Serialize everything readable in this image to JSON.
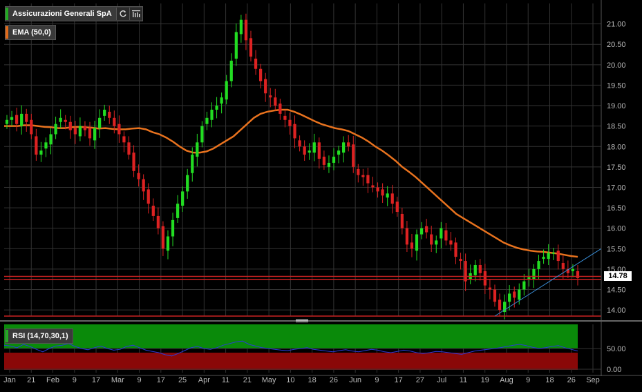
{
  "legend": {
    "instrument": "Assicurazioni Generali SpA",
    "instrument_color": "#22aa22",
    "ema_label": "EMA (50,0)",
    "ema_color": "#e06a1a",
    "rsi_label": "RSI (14,70,30,1)",
    "rsi_color": "#22aa22"
  },
  "toolbar": {
    "refresh_icon": "refresh-icon",
    "settings_icon": "bar-chart-settings-icon"
  },
  "last_price_label": "14.78",
  "colors": {
    "up": "#22dd22",
    "down": "#dd2222",
    "ema": "#e8721e",
    "trend": "#3a8fd9",
    "hline": "#cc2222",
    "rsi": "#2a3ad8",
    "overbought": "#0a8a0a",
    "oversold": "#8a0808",
    "grid": "#333333"
  },
  "chart_data": [
    {
      "type": "candlestick",
      "title": "Assicurazioni Generali SpA",
      "ylim": [
        13.85,
        21.5
      ],
      "y_ticks": [
        "14.00",
        "14.50",
        "15.00",
        "15.50",
        "16.00",
        "16.50",
        "17.00",
        "17.50",
        "18.00",
        "18.50",
        "19.00",
        "19.50",
        "20.00",
        "20.50",
        "21.00"
      ],
      "x_ticks": [
        "Jan",
        "21",
        "Feb",
        "9",
        "17",
        "Mar",
        "9",
        "17",
        "25",
        "Apr",
        "11",
        "21",
        "May",
        "10",
        "18",
        "26",
        "Jun",
        "9",
        "17",
        "27",
        "Jul",
        "11",
        "19",
        "Aug",
        "9",
        "18",
        "26",
        "Sep"
      ],
      "series_close": [
        18.65,
        18.72,
        18.55,
        18.8,
        18.6,
        18.3,
        17.8,
        17.9,
        18.1,
        18.3,
        18.55,
        18.7,
        18.6,
        18.4,
        18.3,
        18.5,
        18.4,
        18.2,
        18.45,
        18.7,
        18.9,
        18.7,
        18.5,
        18.3,
        18.1,
        17.8,
        17.4,
        17.2,
        16.9,
        16.6,
        16.3,
        16.0,
        15.5,
        15.8,
        16.2,
        16.6,
        16.9,
        17.3,
        17.8,
        18.1,
        18.5,
        18.7,
        18.9,
        19.0,
        19.2,
        19.6,
        20.1,
        20.8,
        21.1,
        20.6,
        20.2,
        19.9,
        19.6,
        19.3,
        19.2,
        19.0,
        18.8,
        18.65,
        18.5,
        18.2,
        18.0,
        17.8,
        17.9,
        18.1,
        17.7,
        17.55,
        17.6,
        17.75,
        17.9,
        18.1,
        18.0,
        17.5,
        17.3,
        17.25,
        17.1,
        17.0,
        16.9,
        16.8,
        16.85,
        16.6,
        16.4,
        16.0,
        15.6,
        15.5,
        15.85,
        16.0,
        15.9,
        15.6,
        15.7,
        16.0,
        15.7,
        15.6,
        15.3,
        15.2,
        14.7,
        14.9,
        15.1,
        14.9,
        14.6,
        14.5,
        14.2,
        14.0,
        14.2,
        14.4,
        14.3,
        14.5,
        14.7,
        14.8,
        15.0,
        15.2,
        15.3,
        15.4,
        15.4,
        15.2,
        15.0,
        14.9,
        15.0,
        14.78
      ],
      "ema_50": [
        18.5,
        18.5,
        18.5,
        18.52,
        18.52,
        18.5,
        18.48,
        18.47,
        18.45,
        18.45,
        18.47,
        18.48,
        18.47,
        18.46,
        18.44,
        18.45,
        18.43,
        18.42,
        18.42,
        18.44,
        18.45,
        18.42,
        18.35,
        18.3,
        18.22,
        18.12,
        18.0,
        17.9,
        17.85,
        17.85,
        17.88,
        17.95,
        18.05,
        18.15,
        18.25,
        18.4,
        18.55,
        18.7,
        18.8,
        18.85,
        18.88,
        18.9,
        18.9,
        18.85,
        18.78,
        18.7,
        18.62,
        18.55,
        18.5,
        18.45,
        18.42,
        18.38,
        18.3,
        18.22,
        18.12,
        18.0,
        17.9,
        17.78,
        17.65,
        17.5,
        17.38,
        17.25,
        17.1,
        16.95,
        16.8,
        16.65,
        16.5,
        16.35,
        16.25,
        16.15,
        16.05,
        15.95,
        15.85,
        15.75,
        15.65,
        15.58,
        15.52,
        15.48,
        15.45,
        15.43,
        15.42,
        15.4,
        15.38,
        15.35,
        15.32,
        15.3
      ]
    },
    {
      "type": "line",
      "title": "RSI (14,70,30,1)",
      "ylim": [
        0,
        100
      ],
      "y_ticks": [
        "0.00",
        "50.00"
      ],
      "overbought": 70,
      "oversold": 30,
      "values": [
        58,
        56,
        52,
        60,
        55,
        48,
        42,
        50,
        56,
        58,
        62,
        55,
        50,
        47,
        52,
        56,
        50,
        46,
        48,
        55,
        58,
        52,
        46,
        43,
        40,
        35,
        32,
        38,
        45,
        52,
        55,
        50,
        48,
        52,
        58,
        62,
        66,
        68,
        60,
        56,
        52,
        50,
        48,
        46,
        45,
        48,
        50,
        52,
        48,
        46,
        44,
        42,
        45,
        47,
        44,
        42,
        45,
        48,
        46,
        42,
        40,
        43,
        46,
        44,
        40,
        38,
        40,
        43,
        42,
        40,
        38,
        36,
        40,
        44,
        46,
        48,
        50,
        52,
        55,
        58,
        60,
        57,
        53,
        50,
        52,
        55,
        57,
        52,
        48,
        44
      ]
    }
  ]
}
